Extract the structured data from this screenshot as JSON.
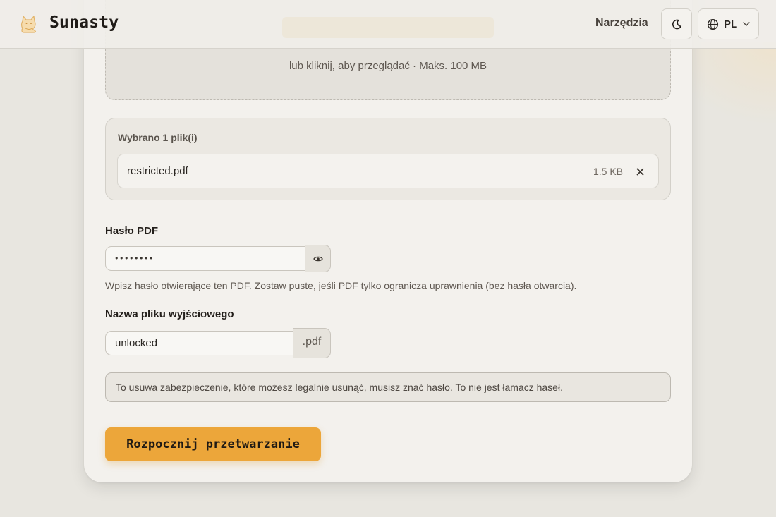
{
  "header": {
    "brand": "Sunasty",
    "nav_tools": "Narzędzia",
    "language": "PL",
    "icons": {
      "logo": "cat-logo-icon",
      "theme": "moon-icon",
      "language": "globe-icon",
      "chevron": "chevron-down-icon"
    }
  },
  "upload": {
    "hint": "lub kliknij, aby przeglądać · Maks. 100 MB"
  },
  "files": {
    "title": "Wybrano 1 plik(i)",
    "items": [
      {
        "name": "restricted.pdf",
        "size": "1.5 KB"
      }
    ]
  },
  "password": {
    "label": "Hasło PDF",
    "value": "••••••••",
    "hint": "Wpisz hasło otwierające ten PDF. Zostaw puste, jeśli PDF tylko ogranicza uprawnienia (bez hasła otwarcia)."
  },
  "output": {
    "label": "Nazwa pliku wyjściowego",
    "value": "unlocked",
    "extension": ".pdf"
  },
  "notice": "To usuwa zabezpieczenie, które możesz legalnie usunąć, musisz znać hasło. To nie jest łamacz haseł.",
  "actions": {
    "start": "Rozpocznij przetwarzanie"
  },
  "colors": {
    "accent": "#eca63a",
    "background": "#e8e6e0",
    "card": "#f3f1ed"
  }
}
